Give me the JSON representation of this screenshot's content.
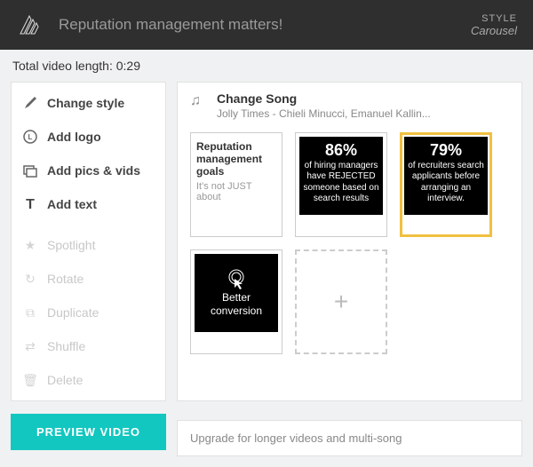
{
  "header": {
    "title": "Reputation management matters!",
    "style_label": "STYLE",
    "style_value": "Carousel"
  },
  "length_prefix": "Total video length: ",
  "length_value": "0:29",
  "sidebar": {
    "change_style": "Change style",
    "add_logo": "Add logo",
    "add_pics": "Add pics & vids",
    "add_text": "Add text",
    "spotlight": "Spotlight",
    "rotate": "Rotate",
    "duplicate": "Duplicate",
    "shuffle": "Shuffle",
    "delete": "Delete"
  },
  "song": {
    "title": "Change Song",
    "subtitle": "Jolly Times - Chieli Minucci, Emanuel Kallin..."
  },
  "slides": {
    "s1_title": "Reputation management goals",
    "s1_sub": "It's not JUST about",
    "s2_pct": "86%",
    "s2_txt": "of hiring managers have REJECTED someone based on search results",
    "s3_pct": "79%",
    "s3_txt": "of recruiters search applicants before arranging an interview.",
    "s4_txt": "Better conversion"
  },
  "preview": "PREVIEW VIDEO",
  "upgrade": "Upgrade for longer videos and multi-song"
}
